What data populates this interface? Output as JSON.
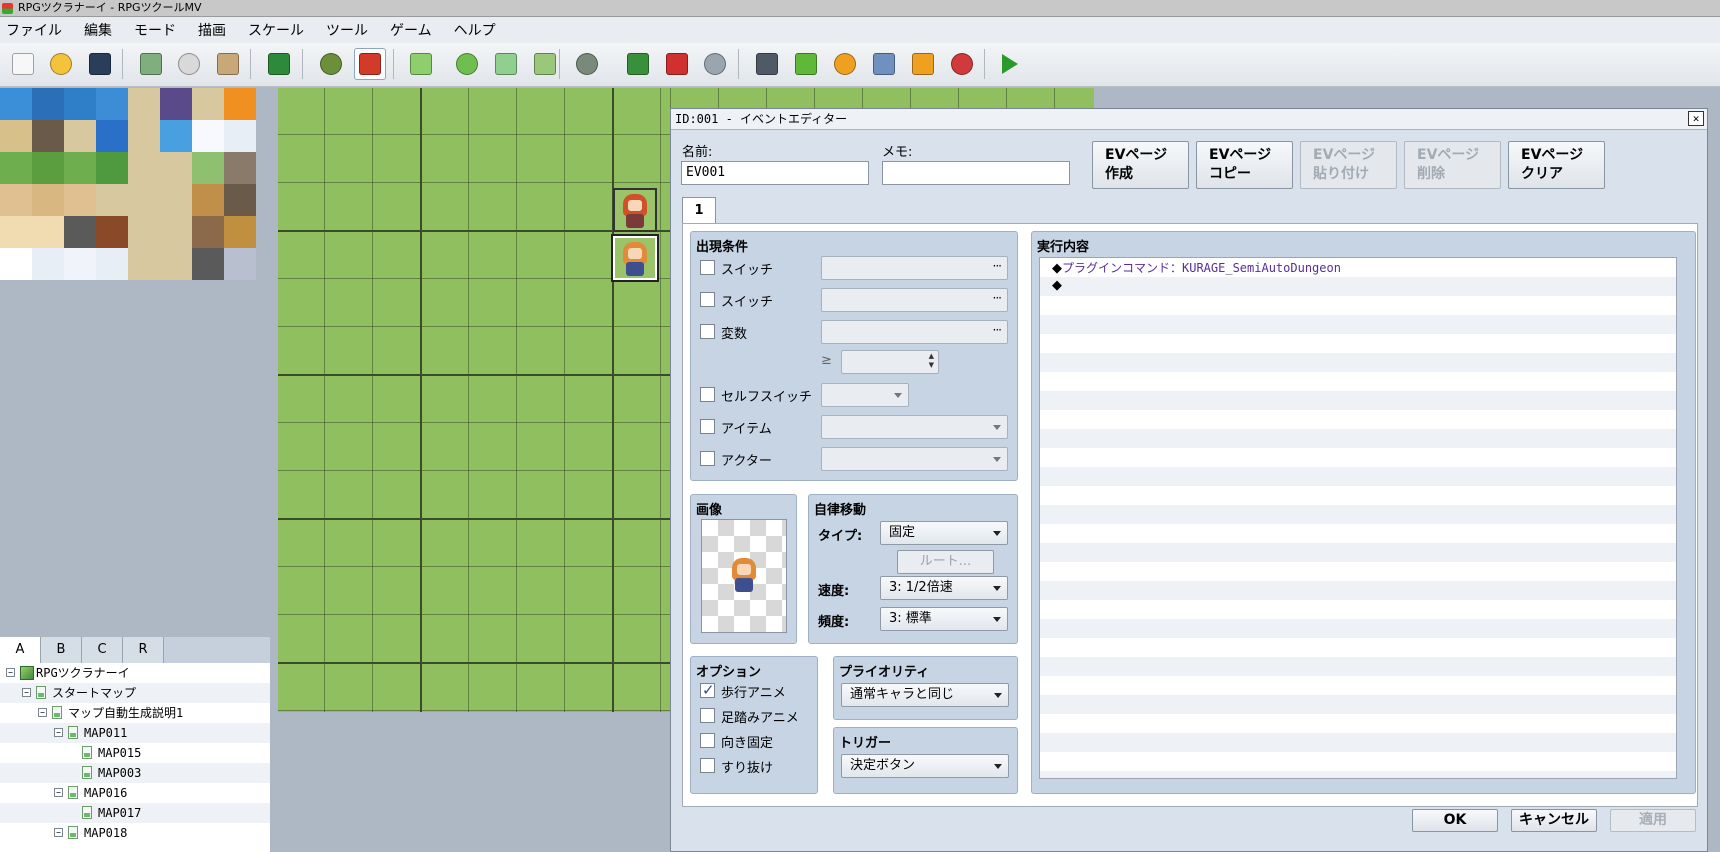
{
  "window": {
    "title": "RPGツクラナーイ - RPGツクールMV"
  },
  "menu": [
    "ファイル",
    "編集",
    "モード",
    "描画",
    "スケール",
    "ツール",
    "ゲーム",
    "ヘルプ"
  ],
  "toolbar": [
    {
      "name": "new-project-icon",
      "color": "#f7f7f7"
    },
    {
      "name": "open-project-icon",
      "color": "#f2c33b"
    },
    {
      "name": "save-project-icon",
      "color": "#2a3d5a"
    },
    {
      "name": "cut-icon",
      "color": "#7fae7f"
    },
    {
      "name": "copy-icon",
      "color": "#d9d9d9"
    },
    {
      "name": "paste-icon",
      "color": "#c8a878"
    },
    {
      "name": "undo-icon",
      "color": "#2c8a3a"
    },
    {
      "name": "map-mode-icon",
      "color": "#6b8f3a"
    },
    {
      "name": "event-mode-icon",
      "color": "#d23a2a"
    },
    {
      "name": "pencil-icon",
      "color": "#8ccf6c"
    },
    {
      "name": "rectangle-icon",
      "color": "#6fbf4f"
    },
    {
      "name": "ellipse-icon",
      "color": "#8fd08f"
    },
    {
      "name": "fill-icon",
      "color": "#9ac77a"
    },
    {
      "name": "shadow-pen-icon",
      "color": "#7a8a7a"
    },
    {
      "name": "zoom-in-icon",
      "color": "#3a8f3a"
    },
    {
      "name": "zoom-out-icon",
      "color": "#d03030"
    },
    {
      "name": "zoom-actual-icon",
      "color": "#9aa5b0"
    },
    {
      "name": "database-icon",
      "color": "#505a66"
    },
    {
      "name": "plugin-manager-icon",
      "color": "#5fb83a"
    },
    {
      "name": "sound-test-icon",
      "color": "#f0a020"
    },
    {
      "name": "event-searcher-icon",
      "color": "#7090c0"
    },
    {
      "name": "resource-manager-icon",
      "color": "#f0a020"
    },
    {
      "name": "character-generator-icon",
      "color": "#d03a3a"
    },
    {
      "name": "playtest-icon",
      "color": "#2a9a2a"
    }
  ],
  "palette": {
    "colors": [
      "#3b8fd8",
      "#2b6fb8",
      "#2f7fc8",
      "#3d8cd6",
      "#d8c8a0",
      "#5a4a8a",
      "#d8c8a0",
      "#f09020",
      "#d8c08a",
      "#6a5a4a",
      "#d8c8a0",
      "#2a6fc8",
      "#d8c8a0",
      "#48a0e0",
      "#f8f8ff",
      "#e8eef6",
      "#6fae4f",
      "#5a9e3f",
      "#6fae4f",
      "#4f9a3f",
      "#d8c8a0",
      "#d8c8a0",
      "#8fc06f",
      "#8a7a6a",
      "#e0c090",
      "#d8b880",
      "#e0c090",
      "#d8c8a0",
      "#d8c8a0",
      "#d8c8a0",
      "#c0904a",
      "#6a5a4a",
      "#f0dcb0",
      "#f0dcb0",
      "#5a5a5a",
      "#8a4a2a",
      "#d8c8a0",
      "#d8c8a0",
      "#8a6a4a",
      "#c09040",
      "#ffffff",
      "#e8eef6",
      "#f0f4fa",
      "#e8eef6",
      "#d8c8a0",
      "#d8c8a0",
      "#5a5a5a",
      "#b8c0d0"
    ]
  },
  "layer_tabs": [
    "A",
    "B",
    "C",
    "R"
  ],
  "tree": [
    {
      "label": "RPGツクラナーイ",
      "level": 0,
      "root": true
    },
    {
      "label": "スタートマップ",
      "level": 1
    },
    {
      "label": "マップ自動生成説明1",
      "level": 2
    },
    {
      "label": "MAP011",
      "level": 3
    },
    {
      "label": "MAP015",
      "level": 4
    },
    {
      "label": "MAP003",
      "level": 4
    },
    {
      "label": "MAP016",
      "level": 3
    },
    {
      "label": "MAP017",
      "level": 4
    },
    {
      "label": "MAP018",
      "level": 3
    }
  ],
  "editor": {
    "title": "ID:001 - イベントエディター",
    "name_label": "名前:",
    "name_value": "EV001",
    "memo_label": "メモ:",
    "memo_value": "",
    "page_buttons": [
      {
        "l1": "EVページ",
        "l2": "作成",
        "disabled": false
      },
      {
        "l1": "EVページ",
        "l2": "コピー",
        "disabled": false
      },
      {
        "l1": "EVページ",
        "l2": "貼り付け",
        "disabled": true
      },
      {
        "l1": "EVページ",
        "l2": "削除",
        "disabled": true
      },
      {
        "l1": "EVページ",
        "l2": "クリア",
        "disabled": false
      }
    ],
    "page_tab": "1",
    "conditions": {
      "title": "出現条件",
      "switch1": "スイッチ",
      "switch2": "スイッチ",
      "variable": "変数",
      "ge": "≥",
      "self_switch": "セルフスイッチ",
      "item": "アイテム",
      "actor": "アクター"
    },
    "image": {
      "title": "画像"
    },
    "autonomous": {
      "title": "自律移動",
      "type_label": "タイプ:",
      "type_value": "固定",
      "route": "ルート...",
      "speed_label": "速度:",
      "speed_value": "3: 1/2倍速",
      "freq_label": "頻度:",
      "freq_value": "3: 標準"
    },
    "options": {
      "title": "オプション",
      "walking": "歩行アニメ",
      "walking_checked": true,
      "stepping": "足踏みアニメ",
      "direction_fix": "向き固定",
      "through": "すり抜け"
    },
    "priority": {
      "title": "プライオリティ",
      "value": "通常キャラと同じ"
    },
    "trigger": {
      "title": "トリガー",
      "value": "決定ボタン"
    },
    "contents": {
      "title": "実行内容",
      "cmd1_prefix": "◆",
      "cmd1_text": "プラグインコマンド：KURAGE_SemiAutoDungeon",
      "cmd2": "◆"
    },
    "ok": "OK",
    "cancel": "キャンセル",
    "apply": "適用"
  }
}
